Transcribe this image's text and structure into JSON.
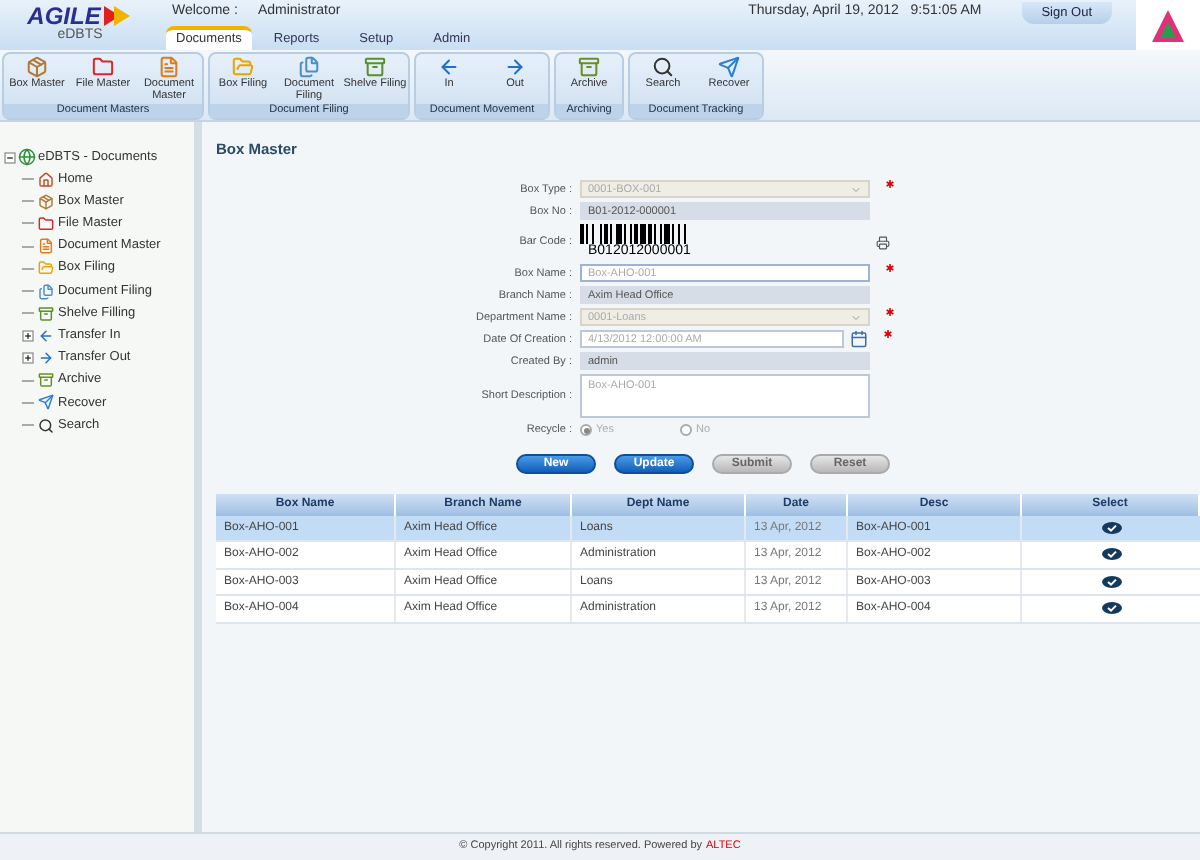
{
  "header": {
    "logo_title": "AGILE",
    "logo_sub": "eDBTS",
    "welcome_label": "Welcome :",
    "user": "Administrator",
    "datetime": "Thursday, April 19, 2012   9:51:05 AM",
    "sign_out": "Sign Out"
  },
  "tabs": [
    {
      "label": "Documents",
      "selected": true
    },
    {
      "label": "Reports",
      "selected": false
    },
    {
      "label": "Setup",
      "selected": false
    },
    {
      "label": "Admin",
      "selected": false
    }
  ],
  "toolbar": [
    {
      "title": "Document Masters",
      "buttons": [
        {
          "label": "Box Master",
          "kind": "box"
        },
        {
          "label": "File Master",
          "kind": "file"
        },
        {
          "label": "Document Master",
          "kind": "document"
        }
      ]
    },
    {
      "title": "Document Filing",
      "buttons": [
        {
          "label": "Box Filing",
          "kind": "boxfiling"
        },
        {
          "label": "Document Filing",
          "kind": "docfiling"
        },
        {
          "label": "Shelve Filing",
          "kind": "shelve"
        }
      ]
    },
    {
      "title": "Document Movement",
      "buttons": [
        {
          "label": "In",
          "kind": "in"
        },
        {
          "label": "Out",
          "kind": "out"
        }
      ]
    },
    {
      "title": "Archiving",
      "buttons": [
        {
          "label": "Archive",
          "kind": "archive"
        }
      ]
    },
    {
      "title": "Document Tracking",
      "buttons": [
        {
          "label": "Search",
          "kind": "search"
        },
        {
          "label": "Recover",
          "kind": "recover"
        }
      ]
    }
  ],
  "tree": {
    "label": "eDBTS - Documents",
    "expanded": true,
    "children": [
      {
        "label": "Home",
        "kind": "home"
      },
      {
        "label": "Box Master",
        "kind": "box"
      },
      {
        "label": "File Master",
        "kind": "file"
      },
      {
        "label": "Document Master",
        "kind": "document"
      },
      {
        "label": "Box Filing",
        "kind": "boxfiling"
      },
      {
        "label": "Document Filing",
        "kind": "docfiling"
      },
      {
        "label": "Shelve Filling",
        "kind": "shelve"
      },
      {
        "label": "Transfer In",
        "kind": "in",
        "expanded": false
      },
      {
        "label": "Transfer Out",
        "kind": "out",
        "expanded": false
      },
      {
        "label": "Archive",
        "kind": "archive"
      },
      {
        "label": "Recover",
        "kind": "recover"
      },
      {
        "label": "Search",
        "kind": "search"
      }
    ]
  },
  "form": {
    "title": "Box Master",
    "fields": [
      {
        "label": "Box Type :",
        "kind": "select",
        "value": "0001-BOX-001",
        "required": true
      },
      {
        "label": "Box No :",
        "kind": "text",
        "value": "B01-2012-000001",
        "readonly": true,
        "required": false
      },
      {
        "label": "Bar Code :",
        "kind": "barcode",
        "value": "B012012000001",
        "required": false
      },
      {
        "label": "Box Name :",
        "kind": "text",
        "value": "Box-AHO-001",
        "readonly": false,
        "required": true
      },
      {
        "label": "Branch Name :",
        "kind": "text",
        "value": "Axim Head Office",
        "readonly": true,
        "required": false
      },
      {
        "label": "Department Name :",
        "kind": "select",
        "value": "0001-Loans",
        "required": true
      },
      {
        "label": "Date Of Creation :",
        "kind": "date",
        "value": "4/13/2012 12:00:00 AM",
        "required": true
      },
      {
        "label": "Created By :",
        "kind": "text",
        "value": "admin",
        "readonly": true,
        "required": false
      },
      {
        "label": "Short Description :",
        "kind": "textarea",
        "value": "Box-AHO-001",
        "required": false
      },
      {
        "label": "Recycle :",
        "kind": "radio",
        "options": [
          {
            "label": "Yes",
            "selected": true
          },
          {
            "label": "No",
            "selected": false
          }
        ],
        "required": false
      }
    ],
    "buttons": [
      {
        "label": "New",
        "disabled": false
      },
      {
        "label": "Update",
        "disabled": false
      },
      {
        "label": "Submit",
        "disabled": true
      },
      {
        "label": "Reset",
        "disabled": true
      }
    ]
  },
  "table": {
    "columns": [
      "Box Name",
      "Branch Name",
      "Dept Name",
      "Date",
      "Desc",
      "Select"
    ],
    "rows": [
      {
        "cells": [
          "Box-AHO-001",
          "Axim Head Office",
          "Loans",
          "13 Apr, 2012",
          "Box-AHO-001"
        ],
        "selected": true
      },
      {
        "cells": [
          "Box-AHO-002",
          "Axim Head Office",
          "Administration",
          "13 Apr, 2012",
          "Box-AHO-002"
        ],
        "selected": false
      },
      {
        "cells": [
          "Box-AHO-003",
          "Axim Head Office",
          "Loans",
          "13 Apr, 2012",
          "Box-AHO-003"
        ],
        "selected": false
      },
      {
        "cells": [
          "Box-AHO-004",
          "Axim Head Office",
          "Administration",
          "13 Apr, 2012",
          "Box-AHO-004"
        ],
        "selected": false
      }
    ]
  },
  "footer": {
    "text": "© Copyright 2011. All rights reserved. Powered by",
    "link": "ALTEC"
  }
}
